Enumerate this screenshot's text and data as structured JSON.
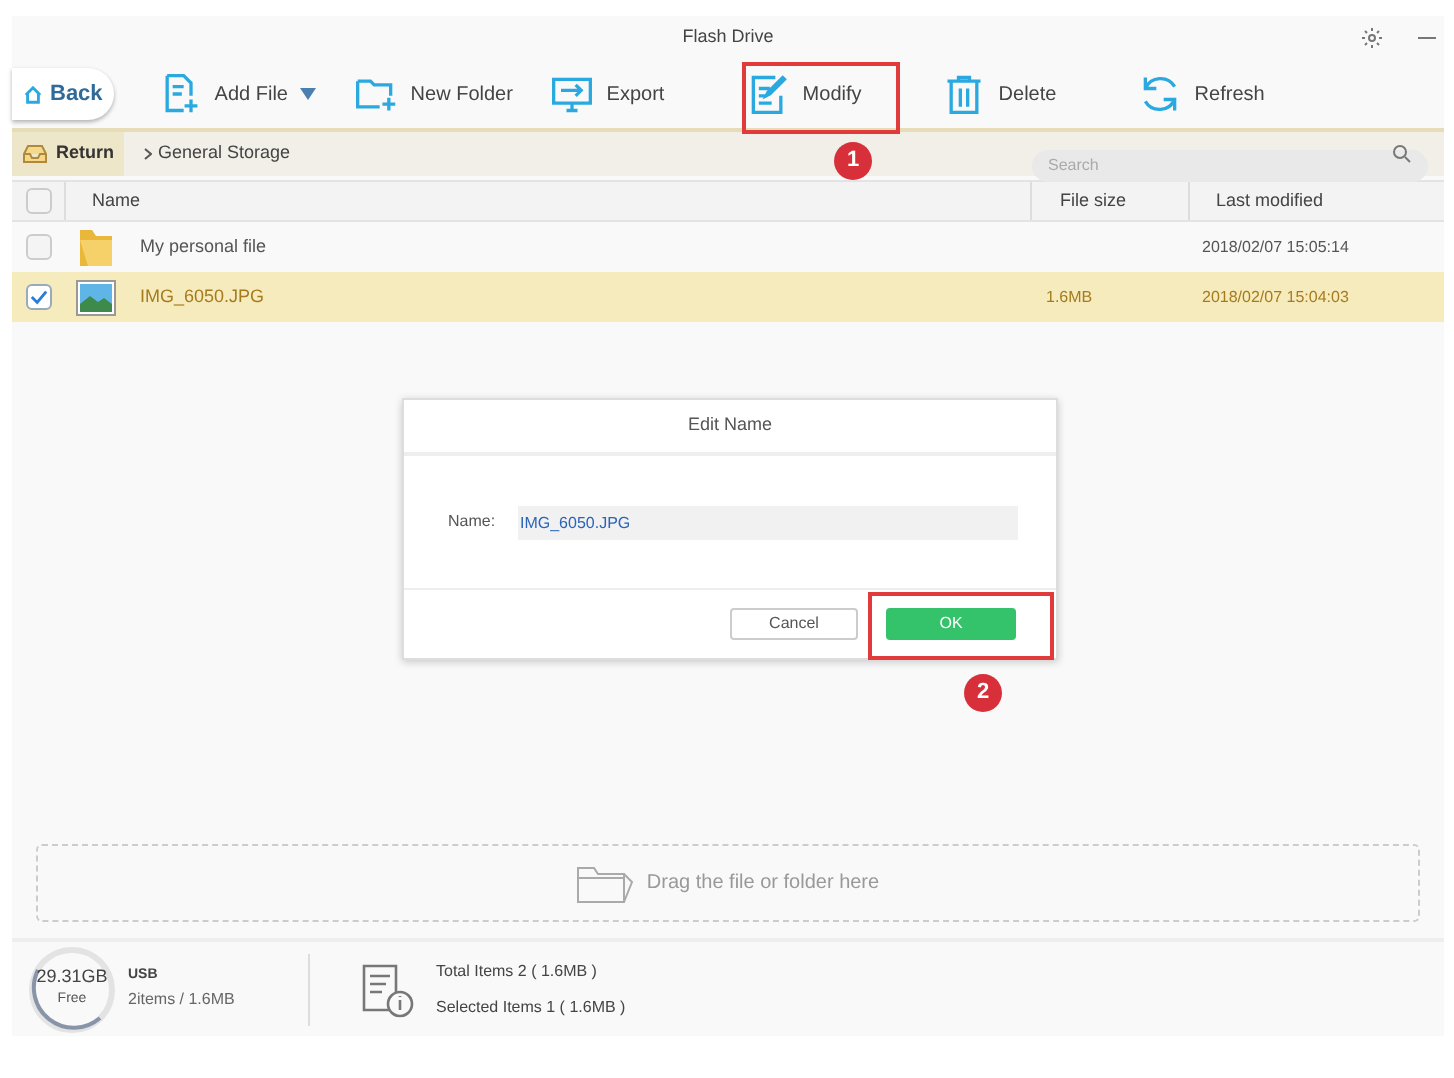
{
  "window": {
    "title": "Flash Drive"
  },
  "toolbar": {
    "back": "Back",
    "buttons": [
      {
        "kind": "add-file",
        "label": "Add File",
        "dropdown": true
      },
      {
        "kind": "new-folder",
        "label": "New Folder",
        "dropdown": false
      },
      {
        "kind": "export",
        "label": "Export",
        "dropdown": false
      },
      {
        "kind": "modify",
        "label": "Modify",
        "dropdown": false
      },
      {
        "kind": "delete",
        "label": "Delete",
        "dropdown": false
      },
      {
        "kind": "refresh",
        "label": "Refresh",
        "dropdown": false
      }
    ]
  },
  "breadcrumb": {
    "return": "Return",
    "path": "General Storage"
  },
  "search": {
    "placeholder": "Search"
  },
  "table": {
    "columns": [
      "Name",
      "File size",
      "Last modified"
    ],
    "all_checked": false,
    "rows": [
      {
        "kind": "folder",
        "name": "My personal file",
        "size": "",
        "modified": "2018/02/07 15:05:14",
        "checked": false,
        "selected": false
      },
      {
        "kind": "image",
        "name": "IMG_6050.JPG",
        "size": "1.6MB",
        "modified": "2018/02/07 15:04:03",
        "checked": true,
        "selected": true
      }
    ]
  },
  "dialog": {
    "title": "Edit Name",
    "field_label": "Name:",
    "value": "IMG_6050.JPG",
    "buttons": [
      "Cancel",
      "OK"
    ]
  },
  "drop_zone": {
    "text": "Drag the file or folder here"
  },
  "footer": {
    "capacity": "29.31GB",
    "capacity_label": "Free",
    "device": "USB",
    "device_info": "2items / 1.6MB",
    "total": "Total Items 2 ( 1.6MB )",
    "selected": "Selected Items 1 ( 1.6MB )"
  },
  "annotations": [
    {
      "label": "1",
      "kind": "toolbar"
    },
    {
      "label": "2",
      "kind": "dialog"
    }
  ]
}
